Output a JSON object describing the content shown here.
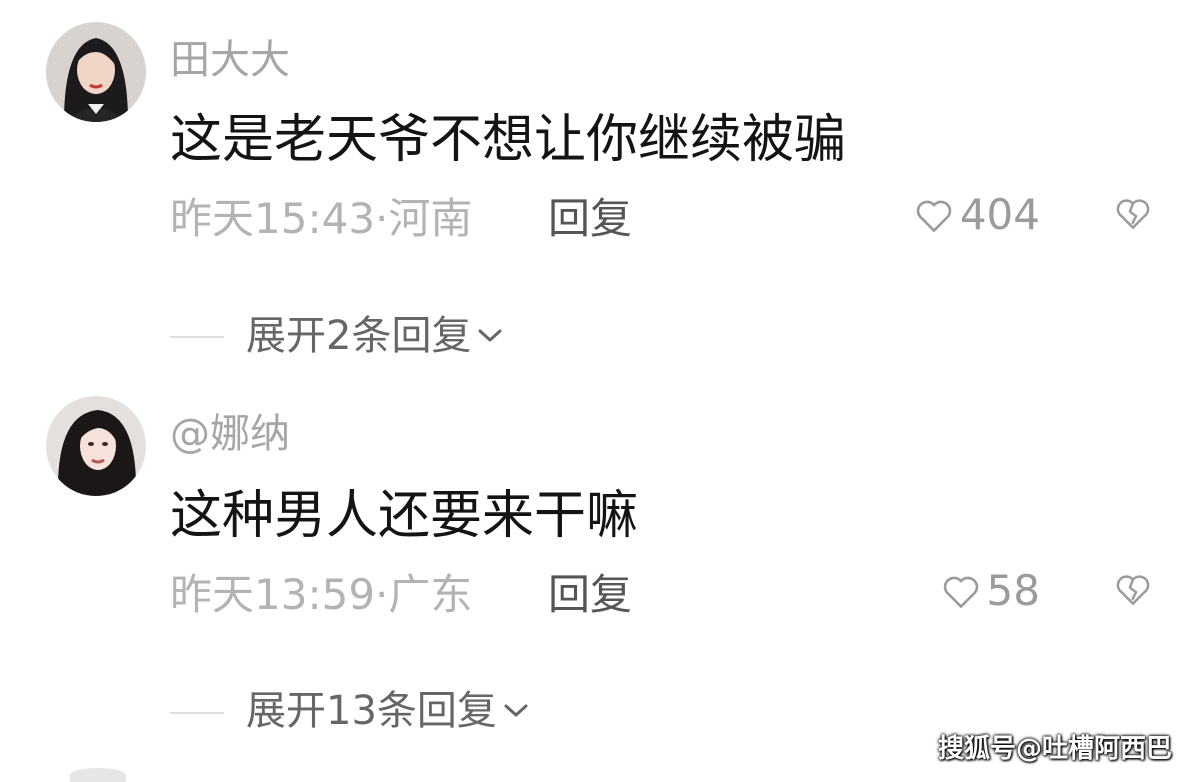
{
  "comments": [
    {
      "username": "田大大",
      "text": "这是老天爷不想让你继续被骗",
      "meta": "昨天15:43·河南",
      "reply_label": "回复",
      "likes": "404",
      "expand_label": "展开2条回复"
    },
    {
      "username": "@娜纳",
      "text": "这种男人还要来干嘛",
      "meta": "昨天13:59·广东",
      "reply_label": "回复",
      "likes": "58",
      "expand_label": "展开13条回复"
    }
  ],
  "icons": {
    "like": "heart-outline-icon",
    "dislike": "broken-heart-icon",
    "expand": "chevron-down-icon"
  },
  "watermark": "搜狐号@吐槽阿西巴",
  "colors": {
    "username": "#a6a6a6",
    "text": "#141414",
    "meta": "#b3b3b3",
    "reply": "#555555",
    "icon": "#9b9b9b"
  }
}
